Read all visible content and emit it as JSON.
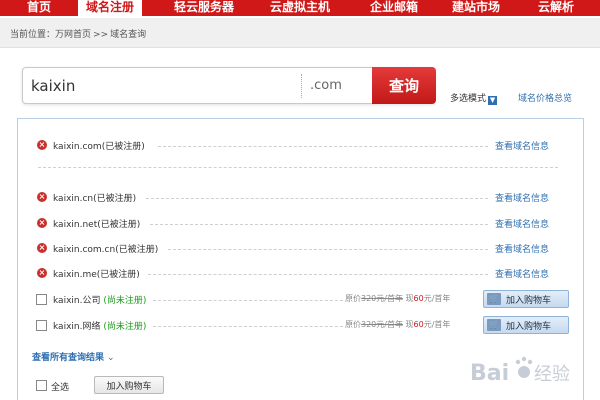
{
  "nav": {
    "items": [
      {
        "label": "首页",
        "active": false
      },
      {
        "label": "域名注册",
        "active": true
      },
      {
        "label": "轻云服务器",
        "active": false
      },
      {
        "label": "云虚拟主机",
        "active": false
      },
      {
        "label": "企业邮箱",
        "active": false
      },
      {
        "label": "建站市场",
        "active": false
      },
      {
        "label": "云解析",
        "active": false
      }
    ]
  },
  "breadcrumb": {
    "prefix": "当前位置：",
    "home": "万网首页",
    "separator": ">>",
    "current": "域名查询"
  },
  "search": {
    "value": "kaixin",
    "tld": ".com",
    "button_label": "查询"
  },
  "options": {
    "mode_label": "多选模式",
    "price_link": "域名价格总览"
  },
  "results": {
    "primary": {
      "domain": "kaixin.com",
      "status": "(已被注册)",
      "link": "查看域名信息"
    },
    "registered": [
      {
        "domain": "kaixin.cn",
        "status": "(已被注册)",
        "link": "查看域名信息"
      },
      {
        "domain": "kaixin.net",
        "status": "(已被注册)",
        "link": "查看域名信息"
      },
      {
        "domain": "kaixin.com.cn",
        "status": "(已被注册)",
        "link": "查看域名信息"
      },
      {
        "domain": "kaixin.me",
        "status": "(已被注册)",
        "link": "查看域名信息"
      }
    ],
    "available": [
      {
        "domain": "kaixin.公司",
        "status": "(尚未注册)",
        "orig_label": "原价",
        "orig_price": "320元/首年",
        "now_label": "现",
        "now_price": "60",
        "now_unit": "元/首年",
        "cart_label": "加入购物车"
      },
      {
        "domain": "kaixin.网络",
        "status": "(尚未注册)",
        "orig_label": "原价",
        "orig_price": "320元/首年",
        "now_label": "现",
        "now_price": "60",
        "now_unit": "元/首年",
        "cart_label": "加入购物车"
      }
    ],
    "view_all": "查看所有查询结果",
    "select_all": "全选",
    "add_all_button": "加入购物车"
  },
  "watermark": {
    "text": "Bai",
    "suffix": "经验"
  },
  "colors": {
    "brand_red": "#d01818",
    "link_blue": "#2f6fb0",
    "available_green": "#1a9a1a",
    "error_red": "#c9302c"
  }
}
